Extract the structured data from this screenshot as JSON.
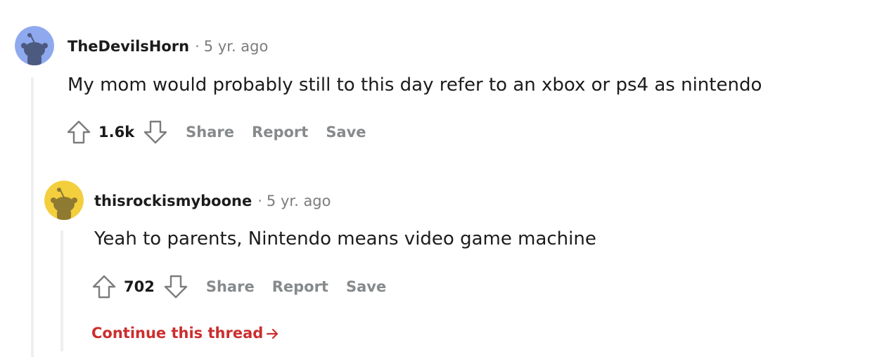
{
  "comments": [
    {
      "author": "TheDevilsHorn",
      "separator": "·",
      "age": "5 yr. ago",
      "body": "My mom would probably still to this day refer to an xbox or ps4 as nintendo",
      "score": "1.6k",
      "actions": {
        "share": "Share",
        "report": "Report",
        "save": "Save"
      },
      "avatar_color": "#8fa9ef"
    },
    {
      "author": "thisrockismyboone",
      "separator": "·",
      "age": "5 yr. ago",
      "body": "Yeah to parents, Nintendo means video game machine",
      "score": "702",
      "actions": {
        "share": "Share",
        "report": "Report",
        "save": "Save"
      },
      "avatar_color": "#f3cf3e"
    }
  ],
  "continue_thread": "Continue this thread",
  "colors": {
    "thread_line": "#edeff1",
    "link_red": "#cc2e2e",
    "muted": "#878a8c"
  }
}
